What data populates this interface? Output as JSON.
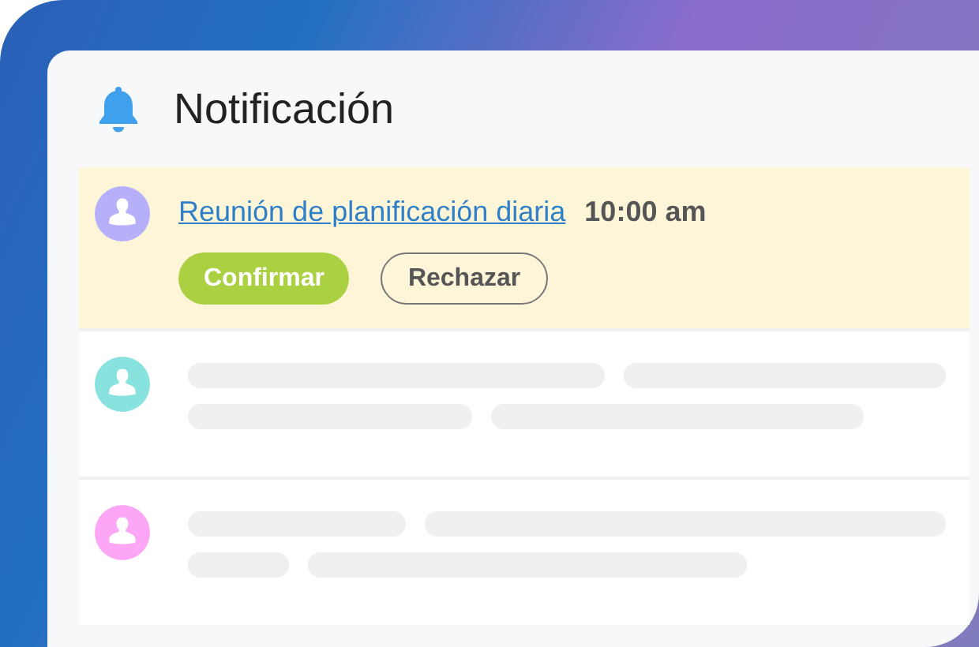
{
  "header": {
    "title": "Notificación"
  },
  "notifications": [
    {
      "kind": "event",
      "highlighted": true,
      "color": "#b6b0fb",
      "title": "Reunión de planificación diaria",
      "time": "10:00 am",
      "actions": [
        {
          "label": "Confirmar",
          "kind": "primary"
        },
        {
          "label": "Rechazar",
          "kind": "secondary"
        }
      ]
    },
    {
      "kind": "placeholder",
      "highlighted": false,
      "color": "#88e2dd"
    },
    {
      "kind": "placeholder",
      "highlighted": false,
      "color": "#fea6f6"
    }
  ]
}
